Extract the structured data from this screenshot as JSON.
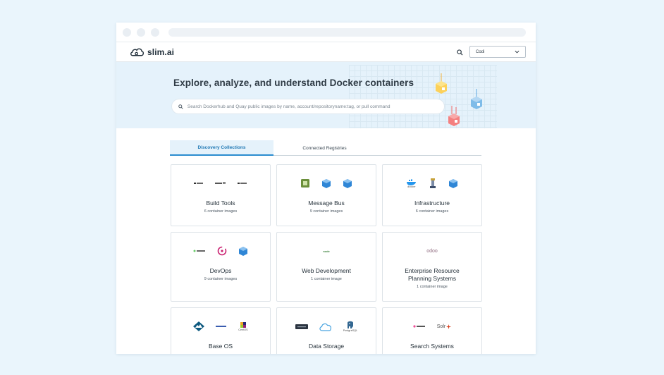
{
  "app": {
    "logo_text": "slim.ai",
    "org_select_value": "Codi"
  },
  "hero": {
    "title": "Explore, analyze, and understand Docker containers",
    "search_placeholder": "Search Dockerhub and Quay public images by name, account/repositoryname:tag, or pull command"
  },
  "tabs": [
    {
      "label": "Discovery Collections",
      "active": true
    },
    {
      "label": "Connected Registries",
      "active": false
    }
  ],
  "cards": [
    {
      "title": "Build Tools",
      "count": "6 container images",
      "logos": [
        "logo-bw-1",
        "logo-bw-2",
        "logo-bw-3"
      ]
    },
    {
      "title": "Message Bus",
      "count": "9 container images",
      "logos": [
        "green-square-logo",
        "blue-cube-logo",
        "blue-cube-logo"
      ]
    },
    {
      "title": "Infrastructure",
      "count": "6 container images",
      "logos": [
        "docker-logo",
        "tower-logo",
        "blue-cube-logo"
      ]
    },
    {
      "title": "DevOps",
      "count": "9 container images",
      "logos": [
        "small-text-logo",
        "consul-logo",
        "blue-cube-logo"
      ]
    },
    {
      "title": "Web Development",
      "count": "1 container image",
      "logos": [
        "node-logo"
      ]
    },
    {
      "title": "Enterprise Resource Planning Systems",
      "count": "1 container image",
      "logos": [
        "odoo-logo"
      ]
    },
    {
      "title": "Base OS",
      "count": "",
      "logos": [
        "alpine-logo",
        "small-text-logo",
        "centos-logo"
      ]
    },
    {
      "title": "Data Storage",
      "count": "",
      "logos": [
        "dark-badge-logo",
        "cloud-logo",
        "postgresql-logo"
      ]
    },
    {
      "title": "Search Systems",
      "count": "",
      "logos": [
        "elastic-logo",
        "solr-logo"
      ]
    }
  ],
  "logo_labels": {
    "docker": "docker",
    "node": "node",
    "odoo": "odoo",
    "centos": "CentOS",
    "postgres": "PostgreSQL",
    "solr": "Solr"
  },
  "colors": {
    "accent": "#2a8ccf",
    "hero_bg": "#e5f2fb",
    "page_bg": "#eaf5fc"
  }
}
